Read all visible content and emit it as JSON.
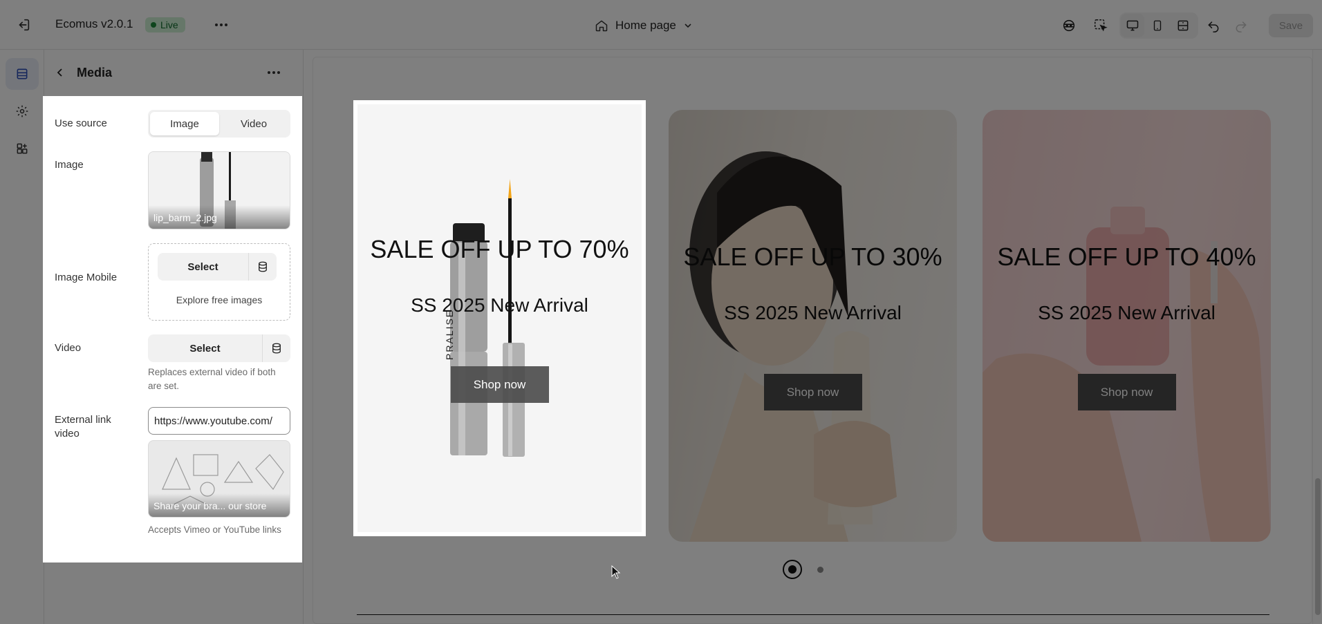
{
  "topbar": {
    "app_title": "Ecomus v2.0.1",
    "status_badge": "Live",
    "page_select": "Home page",
    "save_label": "Save"
  },
  "panel": {
    "title": "Media",
    "use_source_label": "Use source",
    "source_options": [
      "Image",
      "Video"
    ],
    "source_selected": "Image",
    "image_label": "Image",
    "image_filename": "lip_barm_2.jpg",
    "image_mobile_label": "Image Mobile",
    "select_label": "Select",
    "explore_label": "Explore free images",
    "video_label": "Video",
    "video_help": "Replaces external video if both are set.",
    "external_link_label": "External link video",
    "external_link_value": "https://www.youtube.com/",
    "video_thumb_caption": "Share your bra... our store",
    "external_link_help": "Accepts Vimeo or YouTube links"
  },
  "slides": [
    {
      "title": "SALE OFF UP TO 70%",
      "subtitle": "SS 2025 New Arrival",
      "button": "Shop now"
    },
    {
      "title": "SALE OFF UP TO 30%",
      "subtitle": "SS 2025 New Arrival",
      "button": "Shop now"
    },
    {
      "title": "SALE OFF UP TO 40%",
      "subtitle": "SS 2025 New Arrival",
      "button": "Shop now"
    }
  ],
  "product_brand": "PRALISE",
  "pagination": {
    "total": 2,
    "active": 1
  },
  "icons": {
    "exit": "exit-icon",
    "more": "more-horizontal-icon",
    "home": "home-icon",
    "chevron": "chevron-down-icon",
    "ai": "ai-assistant-icon",
    "inspect": "inspect-cursor-icon",
    "desktop": "desktop-icon",
    "mobile": "mobile-icon",
    "fullwidth": "full-width-icon",
    "undo": "undo-icon",
    "redo": "redo-icon",
    "sections": "sections-icon",
    "settings": "gear-icon",
    "apps": "apps-icon",
    "library": "database-icon"
  },
  "colors": {
    "live_bg": "#cdefd3",
    "live_text": "#0f6a2a",
    "rail_active": "#e8ecf7",
    "slide2_bg": "#f1ede8",
    "slide3_bg": "#f6d8d8"
  }
}
